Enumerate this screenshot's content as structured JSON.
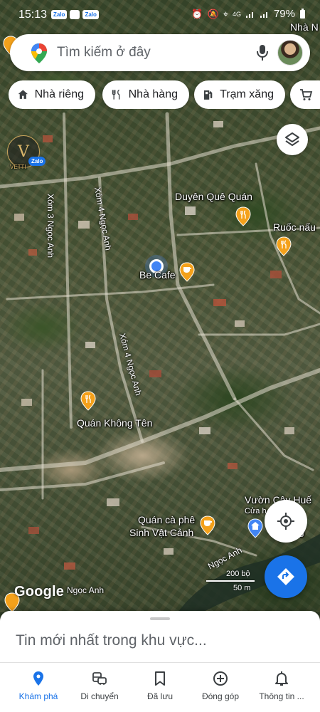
{
  "status_bar": {
    "time": "15:13",
    "badges": [
      "Zalo",
      "",
      "Zalo"
    ],
    "network": "4G",
    "battery": "79%"
  },
  "search": {
    "placeholder": "Tìm kiếm ở đây"
  },
  "chips": [
    {
      "label": "Nhà riêng",
      "icon": "home-icon"
    },
    {
      "label": "Nhà hàng",
      "icon": "restaurant-icon"
    },
    {
      "label": "Trạm xăng",
      "icon": "gas-station-icon"
    },
    {
      "label": "",
      "icon": "shopping-cart-icon"
    }
  ],
  "map": {
    "labels": {
      "top_right": "Nhà N",
      "duyen_que": "Duyên Quê Quán",
      "ruoc_nau": "Ruốc nấu",
      "be_cafe": "Be Cafe",
      "quan_khong_ten": "Quán Không Tên",
      "vuon_cay_hue": "Vườn Cây Huế",
      "vuon_cay_sub": "Cửa h... s... sư",
      "quan_ca_phe_1": "Quán cà phê",
      "quan_ca_phe_2": "Sinh Vật Cảnh",
      "road_xom3": "Xóm 3 Ngọc Anh",
      "road_xom4a": "Xóm 4 Ngọc Anh",
      "road_xom4b": "Xóm 4 Ngọc Anh",
      "road_ngoc_anh": "Ngọc Anh",
      "road_ngoc_anh_2": "Ngọc Anh",
      "vetti": "VETTI",
      "zalo": "Zalo",
      "g_letter": "g"
    },
    "scale": {
      "top": "200 bộ",
      "bottom": "50 m"
    },
    "google": "Google"
  },
  "sheet": {
    "title": "Tin mới nhất trong khu vực..."
  },
  "nav": [
    {
      "label": "Khám phá",
      "icon": "explore-pin-icon",
      "active": true
    },
    {
      "label": "Di chuyển",
      "icon": "commute-icon",
      "active": false
    },
    {
      "label": "Đã lưu",
      "icon": "bookmark-icon",
      "active": false
    },
    {
      "label": "Đóng góp",
      "icon": "add-circle-icon",
      "active": false
    },
    {
      "label": "Thông tin ...",
      "icon": "bell-icon",
      "active": false
    }
  ],
  "colors": {
    "accent": "#1a73e8",
    "poi_orange": "#f4a11b",
    "home_pin_blue": "#4285f4"
  }
}
